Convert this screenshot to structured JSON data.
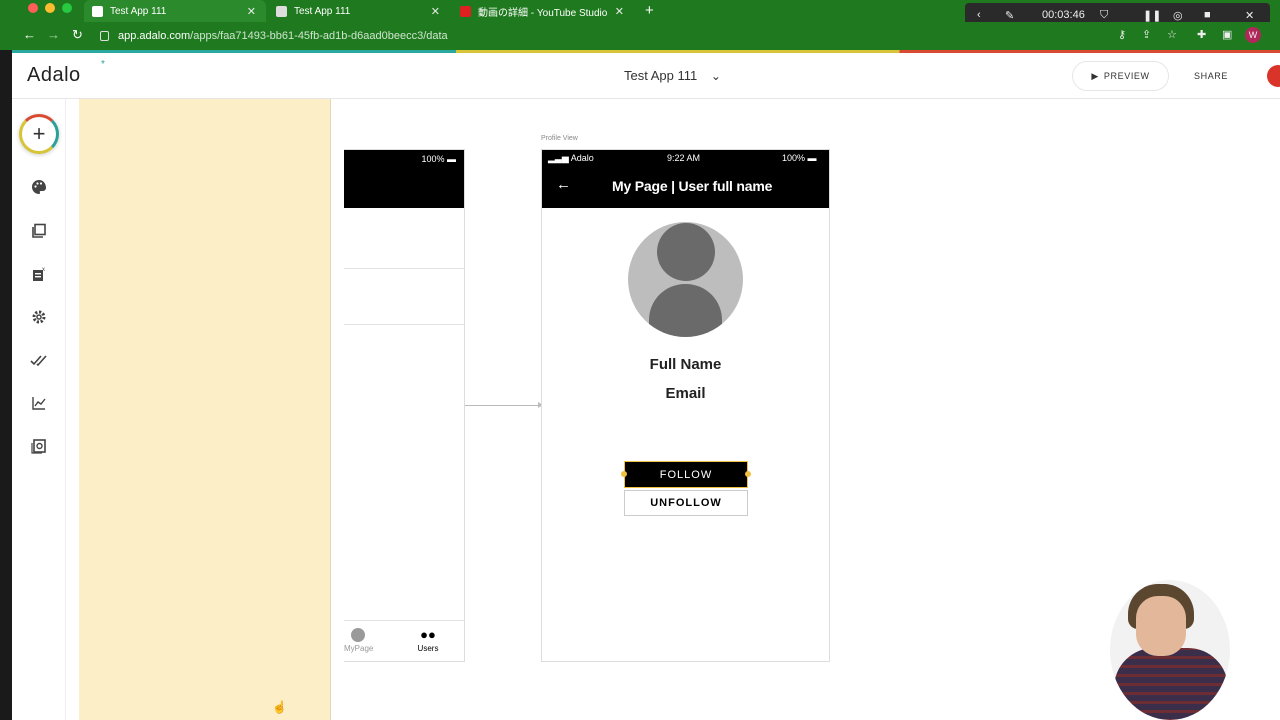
{
  "browser": {
    "tabs": [
      {
        "label": "Test App 111",
        "active": true
      },
      {
        "label": "Test App 111",
        "active": false
      },
      {
        "label": "動画の詳細 - YouTube Studio",
        "active": false
      }
    ],
    "url_host": "app.adalo.com",
    "url_path": "/apps/faa71493-bb61-45fb-ad1b-d6aad0beecc3/data",
    "new_tab_label": "+",
    "recording_time": "00:03:46",
    "profile_initial": "W"
  },
  "app": {
    "logo": "Adalo",
    "logo_star": "*",
    "app_name": "Test App 111",
    "preview_label": "PREVIEW",
    "share_label": "SHARE"
  },
  "sidebar": {
    "add_label": "+",
    "items": [
      {
        "name": "branding",
        "icon": "palette-icon"
      },
      {
        "name": "screens",
        "icon": "screens-icon"
      },
      {
        "name": "database",
        "icon": "database-icon"
      },
      {
        "name": "settings",
        "icon": "gear-icon"
      },
      {
        "name": "publish",
        "icon": "double-check-icon"
      },
      {
        "name": "analytics",
        "icon": "chart-icon"
      },
      {
        "name": "marketplace",
        "icon": "marketplace-icon"
      }
    ]
  },
  "screen_left": {
    "battery": "100%",
    "tabs": [
      {
        "label": "MyPage",
        "icon": "account-icon"
      },
      {
        "label": "Users",
        "icon": "users-icon"
      }
    ]
  },
  "profile_screen": {
    "label": "Profile View",
    "carrier": "Adalo",
    "time": "9:22 AM",
    "battery": "100%",
    "title": "My Page | User full name",
    "back_icon": "←",
    "full_name": "Full Name",
    "email": "Email",
    "follow_label": "FOLLOW",
    "unfollow_label": "UNFOLLOW"
  }
}
